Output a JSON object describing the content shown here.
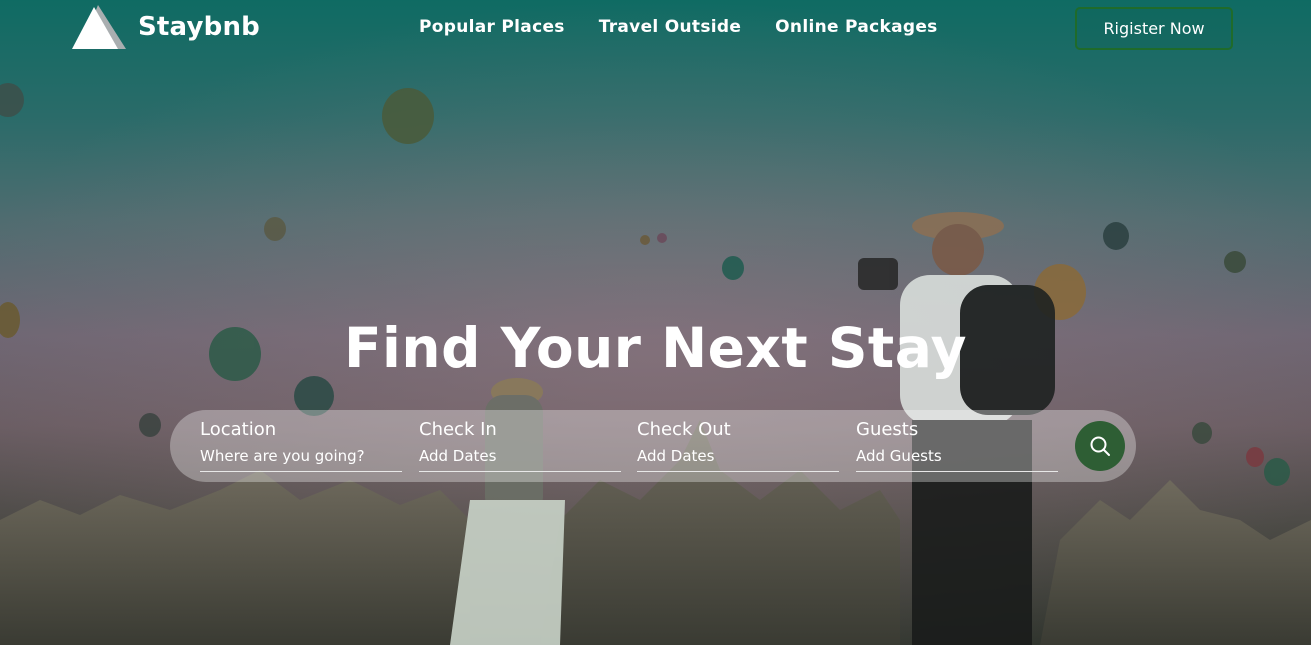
{
  "brand": {
    "name": "Staybnb",
    "logo_icon": "mountain-logo-icon"
  },
  "nav": {
    "items": [
      {
        "label": "Popular Places"
      },
      {
        "label": "Travel Outside"
      },
      {
        "label": "Online Packages"
      }
    ]
  },
  "header": {
    "register_label": "Rigister Now"
  },
  "hero": {
    "title": "Find Your Next Stay",
    "background": "hot-air-balloons-photographer-photo"
  },
  "search": {
    "fields": [
      {
        "label": "Location",
        "placeholder": "Where are you going?"
      },
      {
        "label": "Check In",
        "placeholder": "Add Dates"
      },
      {
        "label": "Check Out",
        "placeholder": "Add Dates"
      },
      {
        "label": "Guests",
        "placeholder": "Add Guests"
      }
    ],
    "button_icon": "search-icon"
  },
  "colors": {
    "accent_green": "#2e5e34",
    "register_border": "#1f6b2a",
    "overlay_teal": "#0f6b63",
    "text": "#ffffff"
  }
}
